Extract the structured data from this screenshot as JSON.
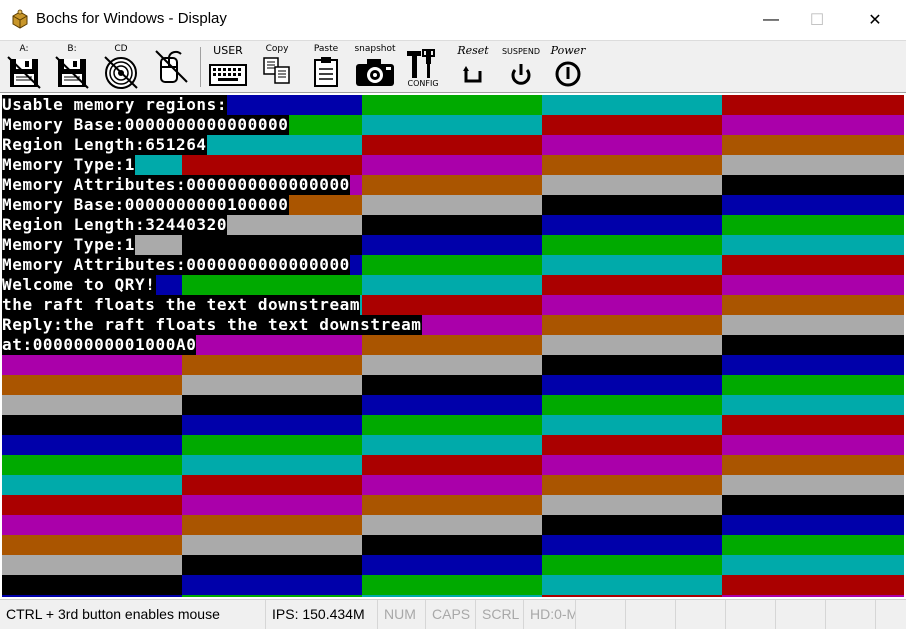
{
  "window": {
    "title": "Bochs for Windows - Display",
    "minimize_glyph": "—",
    "maximize_glyph": "☐",
    "close_glyph": "✕"
  },
  "toolbar": {
    "items": [
      {
        "label": "A:",
        "icon": "floppy-a-icon"
      },
      {
        "label": "B:",
        "icon": "floppy-b-icon"
      },
      {
        "label": "CD",
        "icon": "cdrom-icon"
      },
      {
        "label": "",
        "icon": "mouse-icon"
      },
      {
        "label": "USER",
        "icon": "keyboard-icon"
      },
      {
        "label": "Copy",
        "icon": "copy-icon"
      },
      {
        "label": "Paste",
        "icon": "paste-icon"
      },
      {
        "label": "snapshot",
        "icon": "camera-icon"
      },
      {
        "label": "CONFIG",
        "icon": "config-icon"
      },
      {
        "label": "Reset",
        "icon": "reset-icon"
      },
      {
        "label": "SUSPEND",
        "icon": "suspend-icon"
      },
      {
        "label": "Power",
        "icon": "power-icon"
      }
    ]
  },
  "console": {
    "lines": [
      "Usable memory regions:",
      "Memory Base:0000000000000000",
      "Region Length:651264",
      "Memory Type:1",
      "Memory Attributes:0000000000000000",
      "Memory Base:0000000000100000",
      "Region Length:32440320",
      "Memory Type:1",
      "Memory Attributes:0000000000000000",
      "Welcome to QRY!",
      "the raft floats the text downstream",
      "Reply:the raft floats the text downstream",
      "at:00000000001000A0"
    ]
  },
  "palette": {
    "blue": "#0000aa",
    "green": "#00aa00",
    "cyan": "#00aaaa",
    "red": "#aa0000",
    "magenta": "#aa00aa",
    "brown": "#aa5500",
    "gray": "#aaaaaa",
    "black": "#000000"
  },
  "status": {
    "mouse_hint": "CTRL + 3rd button enables mouse",
    "ips": "IPS: 150.434M",
    "num": "NUM",
    "caps": "CAPS",
    "scrl": "SCRL",
    "hd": "HD:0-M"
  }
}
